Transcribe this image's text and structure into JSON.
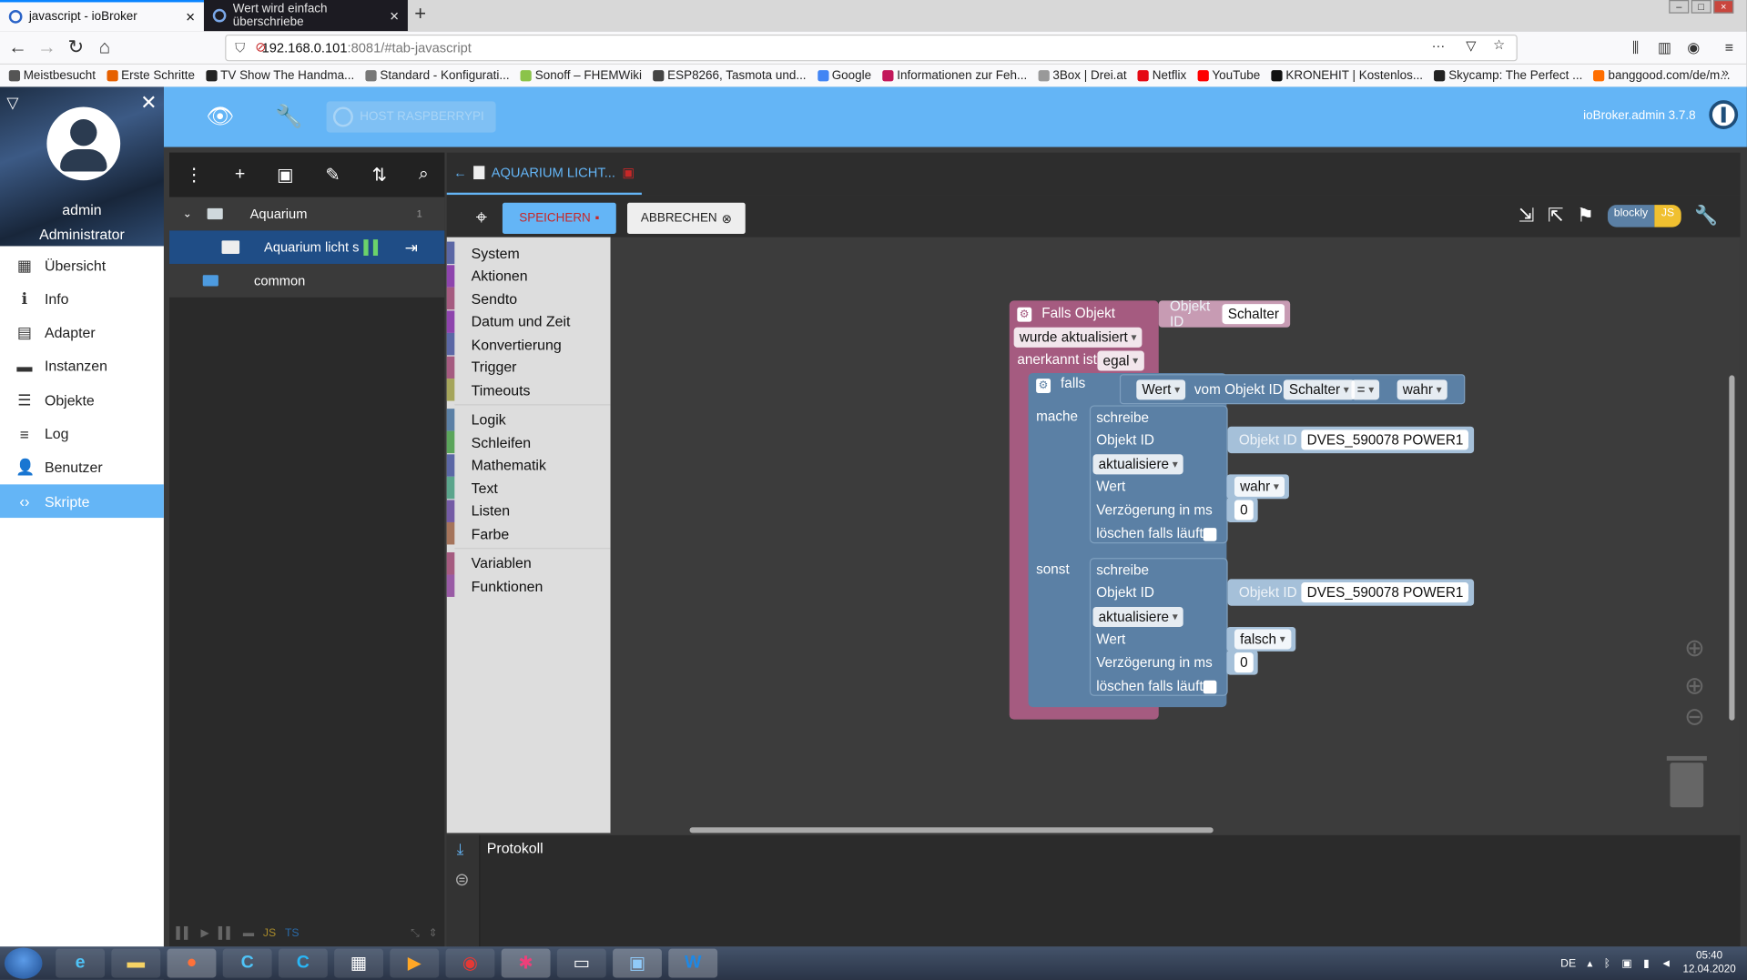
{
  "browser": {
    "tabs": [
      {
        "title": "javascript - ioBroker",
        "close": "×"
      },
      {
        "title": "Wert wird einfach überschriebe",
        "close": "×"
      }
    ],
    "new_tab": "+",
    "url_host": "192.168.0.101",
    "url_rest": ":8081/#tab-javascript",
    "bookmarks": [
      {
        "label": "Meistbesucht",
        "color": "#555555"
      },
      {
        "label": "Erste Schritte",
        "color": "#e66000"
      },
      {
        "label": "TV Show The Handma...",
        "color": "#222222"
      },
      {
        "label": "Standard - Konfigurati...",
        "color": "#777777"
      },
      {
        "label": "Sonoff – FHEMWiki",
        "color": "#8bc34a"
      },
      {
        "label": "ESP8266, Tasmota und...",
        "color": "#444444"
      },
      {
        "label": "Google",
        "color": "#4285f4"
      },
      {
        "label": "Informationen zur Feh...",
        "color": "#c2185b"
      },
      {
        "label": "3Box | Drei.at",
        "color": "#999999"
      },
      {
        "label": "Netflix",
        "color": "#e50914"
      },
      {
        "label": "YouTube",
        "color": "#ff0000"
      },
      {
        "label": "KRONEHIT | Kostenlos...",
        "color": "#111111"
      },
      {
        "label": "Skycamp: The Perfect ...",
        "color": "#222222"
      },
      {
        "label": "banggood.com/de/m...",
        "color": "#ff6e00"
      }
    ]
  },
  "header": {
    "host_label": "HOST RASPBERRYPI",
    "version": "ioBroker.admin 3.7.8"
  },
  "sidebar": {
    "user_name": "admin",
    "user_role": "Administrator",
    "items": [
      {
        "label": "Übersicht",
        "icon": "grid-icon",
        "glyph": "▦"
      },
      {
        "label": "Info",
        "icon": "info-icon",
        "glyph": "ℹ"
      },
      {
        "label": "Adapter",
        "icon": "store-icon",
        "glyph": "▤"
      },
      {
        "label": "Instanzen",
        "icon": "keyboard-icon",
        "glyph": "▬"
      },
      {
        "label": "Objekte",
        "icon": "list-icon",
        "glyph": "☰"
      },
      {
        "label": "Log",
        "icon": "log-icon",
        "glyph": "≡"
      },
      {
        "label": "Benutzer",
        "icon": "user-icon",
        "glyph": "👤"
      },
      {
        "label": "Skripte",
        "icon": "code-icon",
        "glyph": "‹›"
      }
    ]
  },
  "tree": {
    "rows": [
      {
        "label": "Aquarium",
        "badge": "1"
      },
      {
        "label": "Aquarium licht s"
      },
      {
        "label": "common"
      }
    ]
  },
  "editor": {
    "tab_title": "AQUARIUM LICHT...",
    "save_label": "SPEICHERN",
    "cancel_label": "ABBRECHEN",
    "mode_blockly": "blockly",
    "mode_js": "JS",
    "toolbox": [
      {
        "label": "System",
        "color": "#5b67a5"
      },
      {
        "label": "Aktionen",
        "color": "#8e44ad"
      },
      {
        "label": "Sendto",
        "color": "#a55b80"
      },
      {
        "label": "Datum und Zeit",
        "color": "#8e44ad"
      },
      {
        "label": "Konvertierung",
        "color": "#5b67a5"
      },
      {
        "label": "Trigger",
        "color": "#a55b80"
      },
      {
        "label": "Timeouts",
        "color": "#a5a55b"
      },
      {
        "label": "Logik",
        "color": "#5b80a5"
      },
      {
        "label": "Schleifen",
        "color": "#5ba55b"
      },
      {
        "label": "Mathematik",
        "color": "#5b67a5"
      },
      {
        "label": "Text",
        "color": "#5ba58c"
      },
      {
        "label": "Listen",
        "color": "#745ba5"
      },
      {
        "label": "Farbe",
        "color": "#a5745b"
      },
      {
        "label": "Variablen",
        "color": "#a55b80"
      },
      {
        "label": "Funktionen",
        "color": "#995ba5"
      }
    ],
    "blocks": {
      "trigger_title": "Falls Objekt",
      "trigger_objid_label": "Objekt ID",
      "trigger_objid_value": "Schalter",
      "trigger_mode": "wurde aktualisiert",
      "ack_label": "anerkannt ist",
      "ack_value": "egal",
      "if_label": "falls",
      "cond_value_dd": "Wert",
      "cond_from": "vom Objekt ID",
      "cond_obj": "Schalter",
      "cond_op": "=",
      "cond_bool": "wahr",
      "do_label": "mache",
      "else_label": "sonst",
      "write1": {
        "title": "schreibe",
        "objid_label": "Objekt ID",
        "objid_field": "Objekt ID",
        "objid_value": "DVES_590078 POWER1",
        "mode": "aktualisiere",
        "value_label": "Wert",
        "value": "wahr",
        "delay_label": "Verzögerung in ms",
        "delay": "0",
        "clear_label": "löschen falls läuft"
      },
      "write2": {
        "title": "schreibe",
        "objid_label": "Objekt ID",
        "objid_field": "Objekt ID",
        "objid_value": "DVES_590078 POWER1",
        "mode": "aktualisiere",
        "value_label": "Wert",
        "value": "falsch",
        "delay_label": "Verzögerung in ms",
        "delay": "0",
        "clear_label": "löschen falls läuft"
      }
    },
    "log_title": "Protokoll"
  },
  "taskbar": {
    "lang": "DE",
    "time": "05:40",
    "date": "12.04.2020"
  }
}
